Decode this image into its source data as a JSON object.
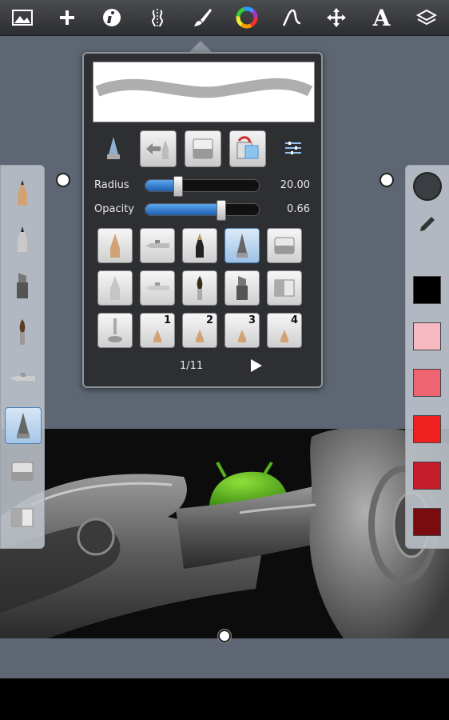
{
  "toolbar": {
    "items": [
      {
        "name": "gallery-icon"
      },
      {
        "name": "add-icon"
      },
      {
        "name": "info-icon"
      },
      {
        "name": "symmetry-icon"
      },
      {
        "name": "brush-icon"
      },
      {
        "name": "color-wheel-icon"
      },
      {
        "name": "stroke-curve-icon"
      },
      {
        "name": "move-transform-icon"
      },
      {
        "name": "text-icon"
      },
      {
        "name": "layers-icon"
      }
    ],
    "text_icon_glyph": "A"
  },
  "brush_panel": {
    "radius_label": "Radius",
    "radius_value": "20.00",
    "radius_fraction": 0.28,
    "opacity_label": "Opacity",
    "opacity_value": "0.66",
    "opacity_fraction": 0.66,
    "preset_numbers": [
      "1",
      "2",
      "3",
      "4"
    ],
    "page_indicator": "1/11"
  },
  "colors": {
    "accent": "#4a90d9",
    "swatches": [
      "#000000",
      "#f7b9c2",
      "#ee6470",
      "#ee2020",
      "#c41c2a",
      "#7a0c10"
    ]
  }
}
